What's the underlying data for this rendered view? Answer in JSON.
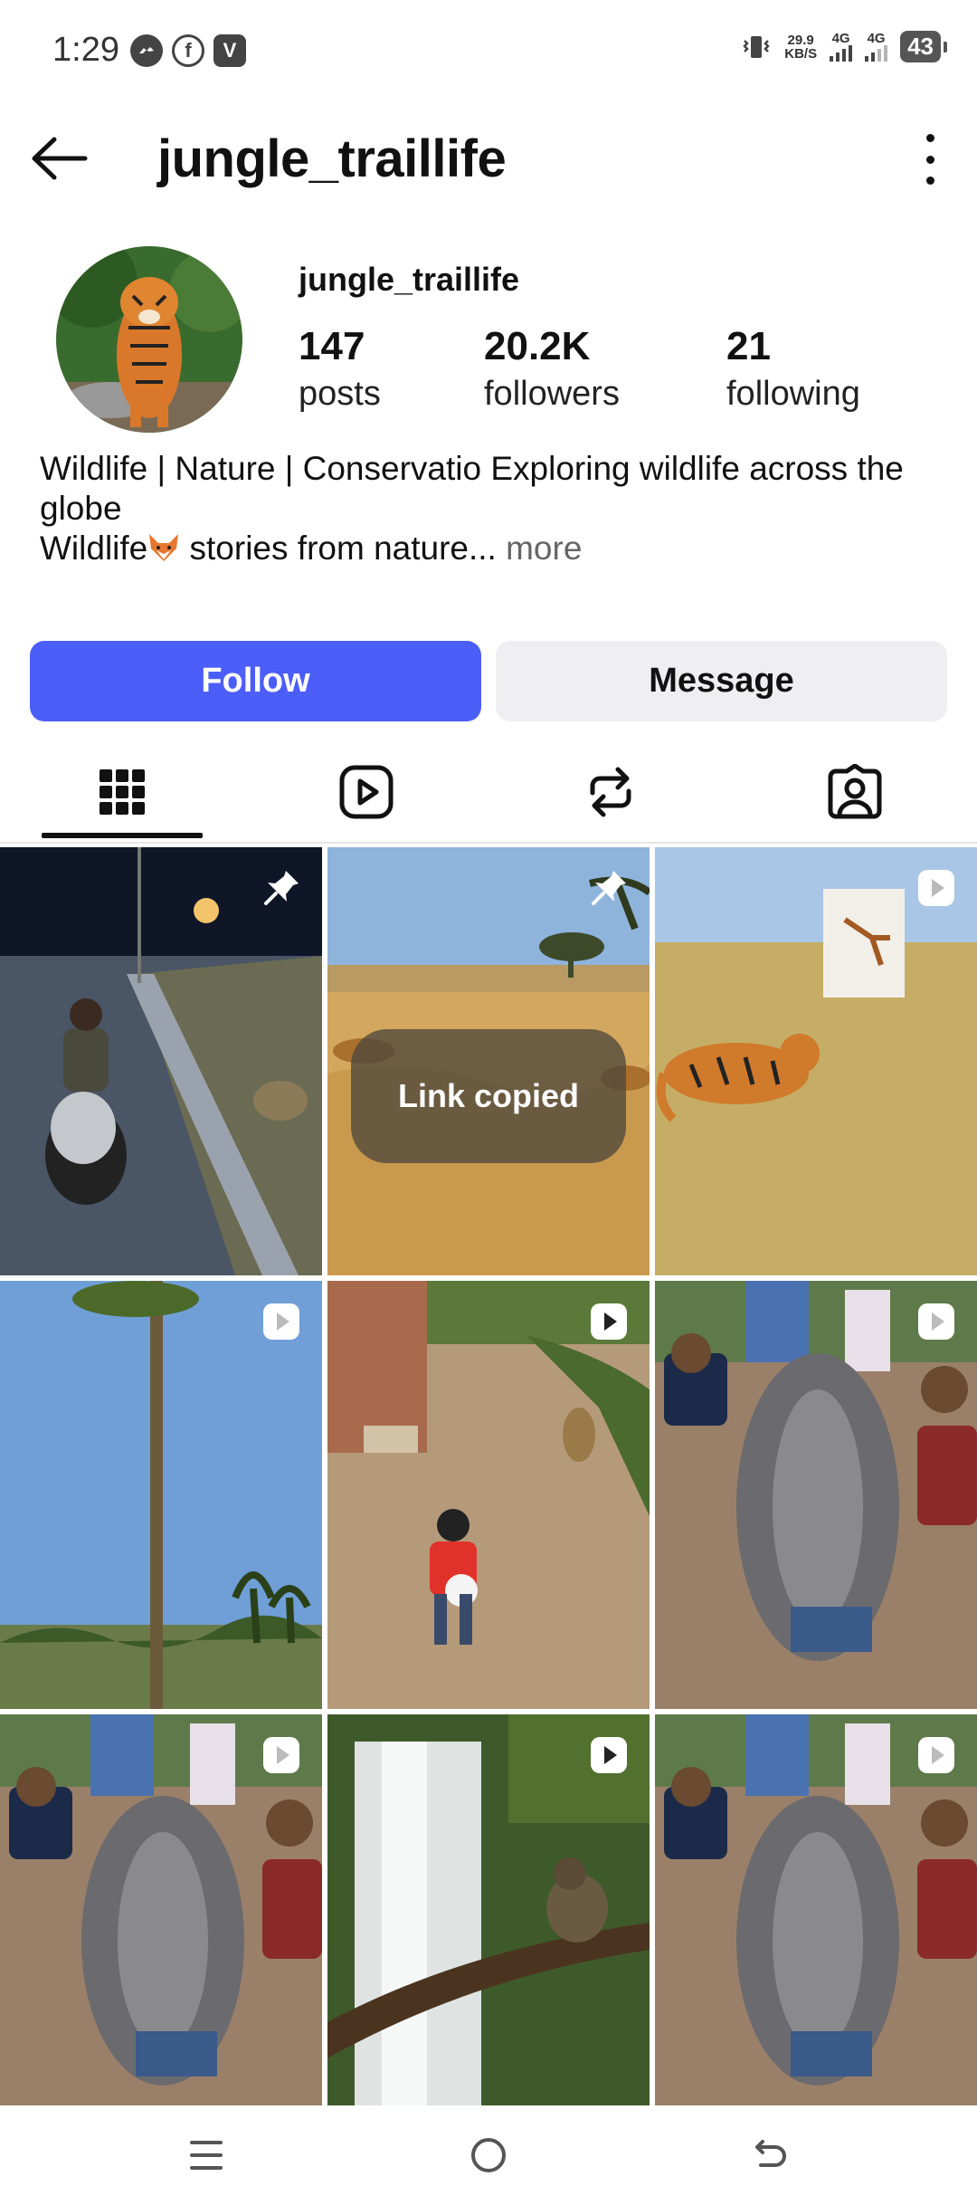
{
  "status_bar": {
    "time": "1:29",
    "app_icons": [
      "messenger-icon",
      "facebook-icon",
      "v-app-icon"
    ],
    "speed_value": "29.9",
    "speed_unit": "KB/S",
    "net1": "4G",
    "net2": "4G",
    "battery": "43"
  },
  "header": {
    "title": "jungle_traillife",
    "back_icon": "arrow-left-icon",
    "menu_icon": "kebab-menu-icon"
  },
  "profile": {
    "username": "jungle_traillife",
    "stats": {
      "posts": {
        "value": "147",
        "label": "posts"
      },
      "followers": {
        "value": "20.2K",
        "label": "followers"
      },
      "following": {
        "value": "21",
        "label": "following"
      }
    },
    "bio": {
      "line1": "Wildlife | Nature | Conservatio Exploring wildlife across the",
      "line2": "globe",
      "line3_prefix": "Wildlife",
      "line3_emoji": "fox-emoji",
      "line3_suffix": " stories from nature...",
      "more": " more"
    }
  },
  "actions": {
    "follow": "Follow",
    "message": "Message"
  },
  "tabs": [
    {
      "name": "grid-icon",
      "active": true
    },
    {
      "name": "reels-icon",
      "active": false
    },
    {
      "name": "reposts-icon",
      "active": false
    },
    {
      "name": "tagged-icon",
      "active": false
    }
  ],
  "posts": [
    {
      "scene": "night-road-motorbike",
      "badge": "pin-icon"
    },
    {
      "scene": "savanna-cheetah-chase",
      "badge": "pin-icon"
    },
    {
      "scene": "tiger-grassland",
      "badge": "reel-icon"
    },
    {
      "scene": "palm-tree-sky",
      "badge": "reel-icon"
    },
    {
      "scene": "boy-football-leopard",
      "badge": "reel-icon"
    },
    {
      "scene": "giant-catfish-riverbank",
      "badge": "reel-icon"
    },
    {
      "scene": "giant-catfish-riverbank",
      "badge": "reel-icon"
    },
    {
      "scene": "waterfall-monkey",
      "badge": "reel-icon"
    },
    {
      "scene": "giant-catfish-riverbank",
      "badge": "reel-icon"
    }
  ],
  "toast": "Link copied",
  "nav": [
    "recent-apps-icon",
    "home-icon",
    "back-nav-icon"
  ]
}
